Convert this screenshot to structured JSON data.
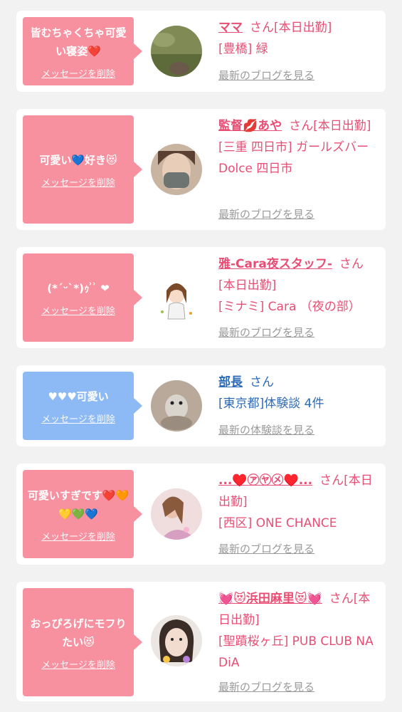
{
  "delete_label": "メッセージを削除",
  "colors": {
    "pink_bubble": "#f7909f",
    "blue_bubble": "#8db9f4",
    "pink_text": "#e84e74",
    "blue_text": "#2e6bb6"
  },
  "items": [
    {
      "message": "皆むちゃくちゃ可愛い寝姿❤️",
      "bubble_color": "pink",
      "avatar": "grass-photo",
      "name": "ママ",
      "suffix": "さん[本日出勤]",
      "place": "[豊橋] 緑",
      "link": "最新のブログを見る"
    },
    {
      "message": "可愛い💙好き😻",
      "bubble_color": "pink",
      "avatar": "masked-woman-photo",
      "name": "監督💋あや",
      "suffix": "さん[本日出勤]",
      "place": "[三重 四日市] ガールズバー Dolce 四日市",
      "link": "最新のブログを見る"
    },
    {
      "message": "(*´ᵕ`*)ｩ ͗ ͗ ❤",
      "bubble_color": "pink",
      "avatar": "cartoon-girl-illustration",
      "name": "雅-Cara夜スタッフ-",
      "suffix": "さん[本日出勤]",
      "place": "[ミナミ] Cara （夜の部）",
      "link": "最新のブログを見る"
    },
    {
      "message": "♥♥♥可愛い",
      "bubble_color": "blue",
      "avatar": "small-animal-photo",
      "name": "部長",
      "suffix": "さん",
      "place": "[東京都]体験談 4件",
      "link": "最新の体験談を見る"
    },
    {
      "message": "可愛いすぎです❤️🧡💛💚💙",
      "bubble_color": "pink",
      "avatar": "woman-photo",
      "name": "...♥️㋐㋳㋱♥️...",
      "suffix": "さん[本日出勤]",
      "place": "[西区] ONE CHANCE",
      "link": "最新のブログを見る"
    },
    {
      "message": "おっぴろげにモフりたい😻",
      "bubble_color": "pink",
      "avatar": "woman-filter-photo",
      "name": "💓😻浜田麻里😻💓",
      "suffix": "さん[本日出勤]",
      "place": "[聖蹟桜ヶ丘] PUB CLUB NADiA",
      "link": "最新のブログを見る"
    }
  ]
}
